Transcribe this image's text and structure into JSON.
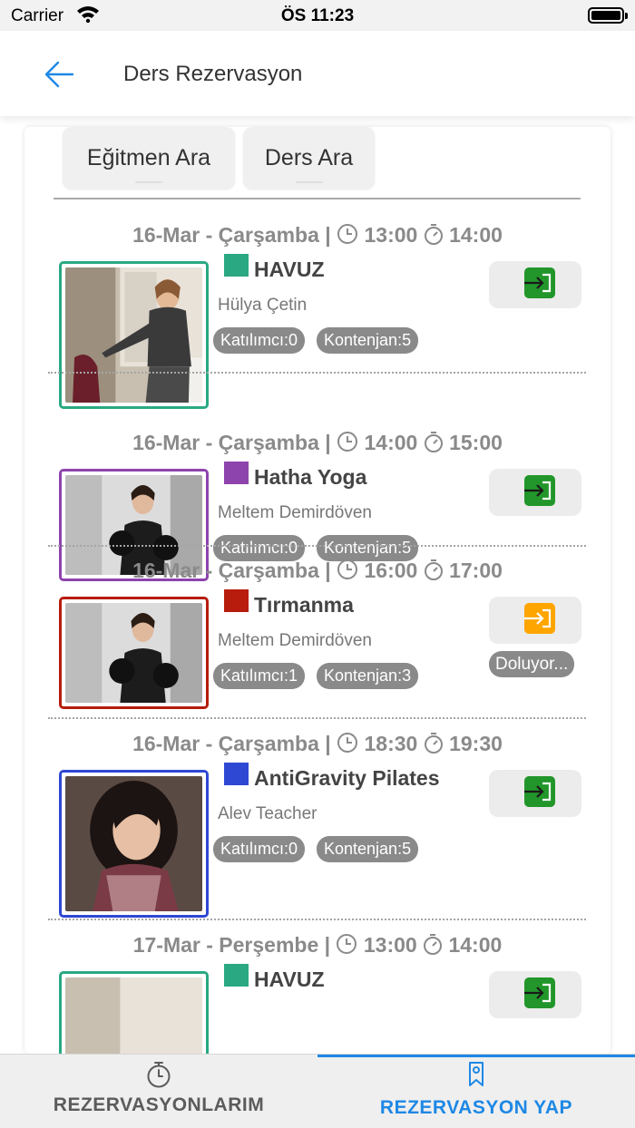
{
  "status_bar": {
    "carrier": "Carrier",
    "time": "ÖS 11:23"
  },
  "header": {
    "title": "Ders Rezervasyon",
    "back_icon": "arrow-left-icon"
  },
  "search": {
    "instructor_label": "Eğitmen Ara",
    "lesson_label": "Ders Ara"
  },
  "lessons": [
    {
      "date": "16-Mar - Çarşamba |",
      "start": "13:00",
      "end": "14:00",
      "name": "HAVUZ",
      "color": "#2aa882",
      "teacher": "Hülya Çetin",
      "participants": "Katılımcı:0",
      "capacity": "Kontenjan:5",
      "button_color": "#22962a",
      "filling": ""
    },
    {
      "date": "16-Mar - Çarşamba |",
      "start": "14:00",
      "end": "15:00",
      "name": "Hatha Yoga",
      "color": "#8e44ad",
      "teacher": "Meltem Demirdöven",
      "participants": "Katılımcı:0",
      "capacity": "Kontenjan:5",
      "button_color": "#22962a",
      "filling": ""
    },
    {
      "date": "16-Mar - Çarşamba |",
      "start": "16:00",
      "end": "17:00",
      "name": "Tırmanma",
      "color": "#b71c0c",
      "teacher": "Meltem Demirdöven",
      "participants": "Katılımcı:1",
      "capacity": "Kontenjan:3",
      "button_color": "#ffa500",
      "filling": "Doluyor..."
    },
    {
      "date": "16-Mar - Çarşamba |",
      "start": "18:30",
      "end": "19:30",
      "name": "AntiGravity Pilates",
      "color": "#2f48d4",
      "teacher": "Alev Teacher",
      "participants": "Katılımcı:0",
      "capacity": "Kontenjan:5",
      "button_color": "#22962a",
      "filling": ""
    },
    {
      "date": "17-Mar - Perşembe |",
      "start": "13:00",
      "end": "14:00",
      "name": "HAVUZ",
      "color": "#2aa882",
      "teacher": "",
      "participants": "",
      "capacity": "",
      "button_color": "#22962a",
      "filling": ""
    }
  ],
  "tabs": [
    {
      "label": "REZERVASYONLARIM",
      "icon": "stopwatch-icon"
    },
    {
      "label": "REZERVASYON YAP",
      "icon": "bookmark-icon"
    }
  ]
}
